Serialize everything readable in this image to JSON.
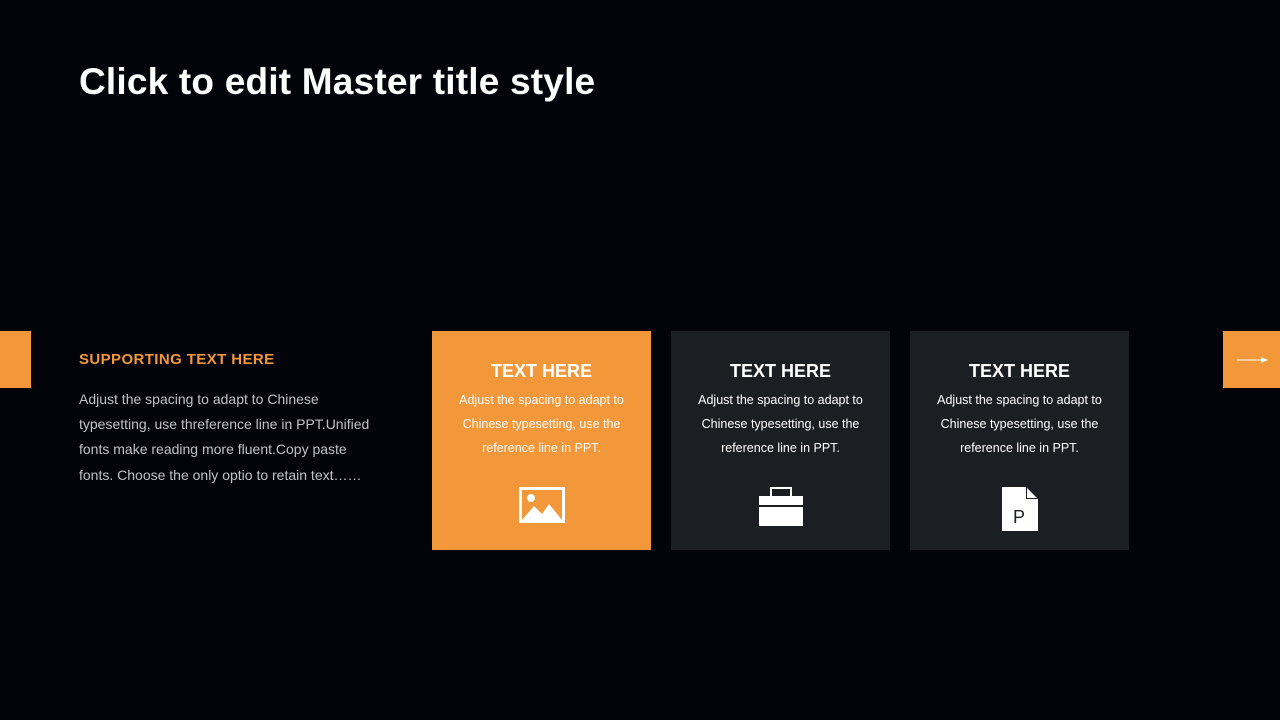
{
  "title": "Click to edit Master title style",
  "supporting": {
    "heading": "SUPPORTING TEXT HERE",
    "body": "Adjust the spacing to adapt to Chinese typesetting, use threference line in PPT.Unified fonts make reading more fluent.Copy paste fonts. Choose the only optio to retain text……"
  },
  "cards": [
    {
      "title": "TEXT HERE",
      "body": "Adjust the spacing to adapt to Chinese typesetting, use the reference line in PPT.",
      "icon": "image-icon",
      "background": "#f2973a"
    },
    {
      "title": "TEXT HERE",
      "body": "Adjust the spacing to adapt to Chinese typesetting, use the reference line in PPT.",
      "icon": "briefcase-icon",
      "background": "#1b1e23"
    },
    {
      "title": "TEXT HERE",
      "body": "Adjust the spacing to adapt to Chinese typesetting, use the reference line in PPT.",
      "icon": "document-p-icon",
      "icon_letter": "P",
      "background": "#1b1e23"
    }
  ],
  "colors": {
    "background": "#02040a",
    "accent": "#f2973a",
    "card": "#1b1e23"
  },
  "navigation": {
    "next_icon": "arrow-right-icon"
  }
}
